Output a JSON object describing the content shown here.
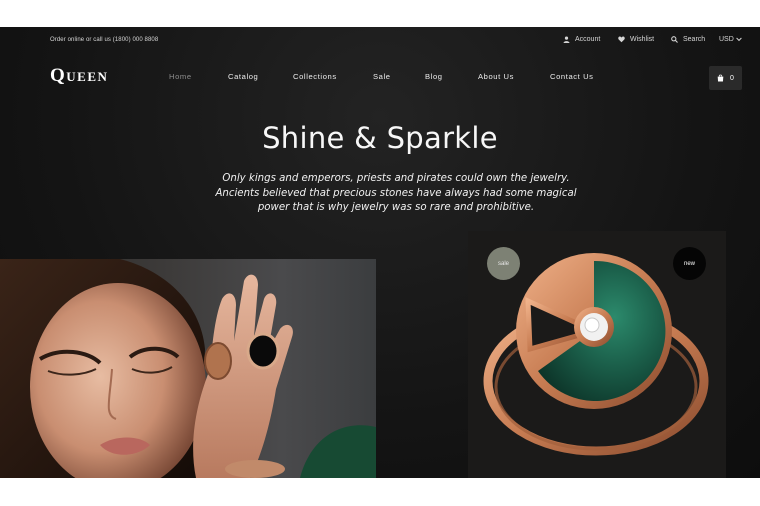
{
  "topbar": {
    "order_text": "Order online or call us (1800) 000 8808",
    "account": "Account",
    "wishlist": "Wishlist",
    "search": "Search",
    "currency": "USD"
  },
  "brand": {
    "logo": "Queen"
  },
  "nav": {
    "items": [
      "Home",
      "Catalog",
      "Collections",
      "Sale",
      "Blog",
      "About Us",
      "Contact Us"
    ],
    "cart_count": "0"
  },
  "hero": {
    "title": "Shine & Sparkle",
    "text": "Only kings and emperors, priests and pirates could own the jewelry. Ancients believed that precious stones have always had some magical power that is why jewelry was so rare and prohibitive."
  },
  "product_card": {
    "badge_sale": "sale",
    "badge_new": "new"
  },
  "colors": {
    "background": "#141414",
    "accent_gold": "#c98a63",
    "malachite": "#1f6b55",
    "sale_badge": "#7d8174"
  },
  "icons": {
    "account": "user-icon",
    "wishlist": "heart-icon",
    "search": "search-icon",
    "currency": "chevron-down-icon",
    "cart": "shopping-bag-icon"
  }
}
